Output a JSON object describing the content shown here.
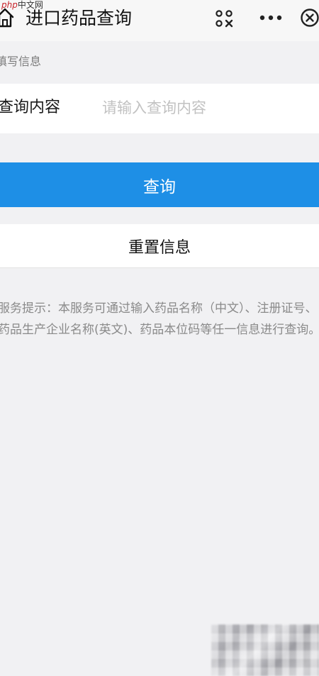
{
  "navbar": {
    "title": "进口药品查询",
    "watermark_latin": "php",
    "watermark_cn": "中文网",
    "icons": {
      "home": "home-icon",
      "scan": "scan-icon",
      "more": "more-icon",
      "close": "close-circle-icon"
    }
  },
  "form": {
    "section_label": "填写信息",
    "field_label": "查询内容",
    "field_value": "",
    "field_placeholder": "请输入查询内容"
  },
  "actions": {
    "query_label": "查询",
    "reset_label": "重置信息"
  },
  "tip": {
    "text": "服务提示：本服务可通过输入药品名称（中文）、注册证号、药品生产企业名称(英文)、药品本位码等任一信息进行查询。"
  },
  "colors": {
    "primary": "#1e8fe6",
    "background": "#f1f1f3",
    "watermark": "#c8242b"
  }
}
